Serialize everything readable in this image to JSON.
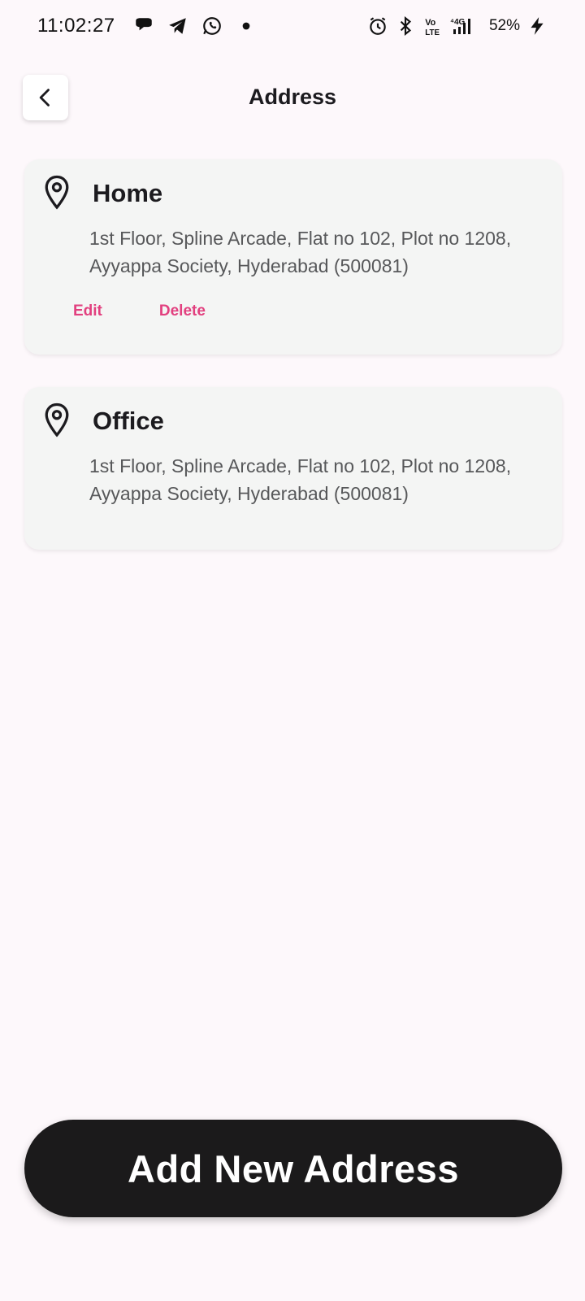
{
  "status_bar": {
    "time": "11:02:27",
    "battery": "52%",
    "left_icons": [
      "chat-bubble-icon",
      "telegram-icon",
      "whatsapp-icon",
      "notification-dot-icon"
    ],
    "right_icons": [
      "alarm-icon",
      "bluetooth-icon",
      "volte-icon",
      "network-4g-icon",
      "signal-icon",
      "charging-bolt-icon"
    ],
    "network_label": "4G",
    "volte_label": "Vo LTE"
  },
  "header": {
    "title": "Address",
    "back_icon": "chevron-left-icon"
  },
  "addresses": [
    {
      "name": "Home",
      "address": "1st Floor, Spline Arcade, Flat no 102, Plot no 1208, Ayyappa Society, Hyderabad (500081)",
      "edit_label": "Edit",
      "delete_label": "Delete",
      "icon": "location-pin-icon"
    },
    {
      "name": "Office",
      "address": "1st Floor, Spline Arcade, Flat no 102, Plot no 1208, Ayyappa Society, Hyderabad (500081)",
      "icon": "location-pin-icon"
    }
  ],
  "add_button_label": "Add New Address",
  "colors": {
    "background": "#fdf8fb",
    "card": "#f4f5f4",
    "accent": "#e2407f",
    "button": "#1b1a1b"
  }
}
